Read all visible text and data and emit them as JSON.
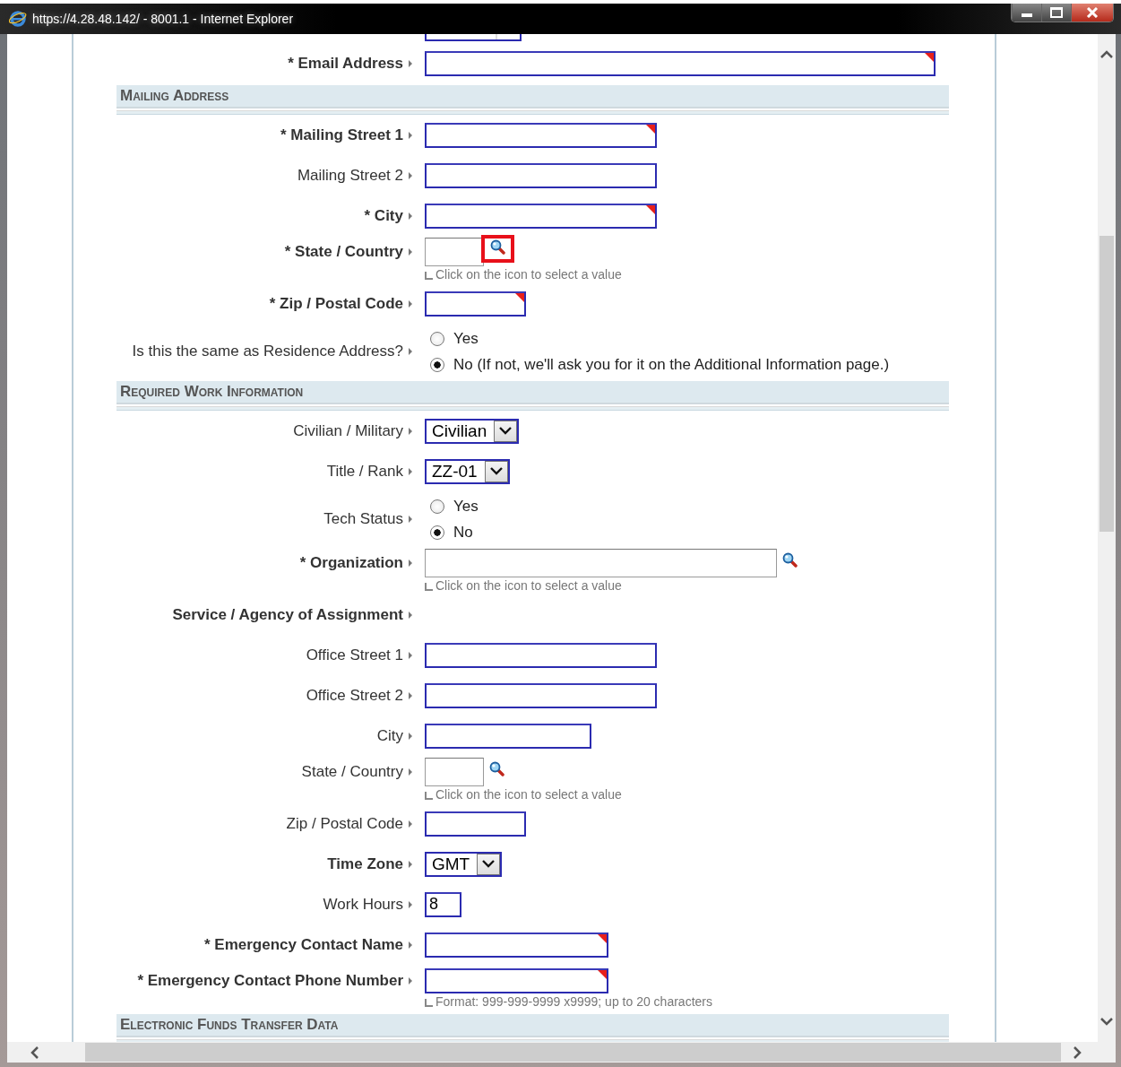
{
  "window": {
    "title": "https://4.28.48.142/ - 8001.1 - Internet Explorer"
  },
  "form": {
    "rows": [
      {
        "kind": "partial"
      },
      {
        "kind": "text",
        "label": "* Email Address",
        "bold": true,
        "field": {
          "kind": "xlarge"
        },
        "flagged": true
      },
      {
        "kind": "section",
        "label": "Mailing Address"
      },
      {
        "kind": "text",
        "label": "* Mailing Street 1",
        "bold": true,
        "field": {
          "kind": "large"
        },
        "flagged": true
      },
      {
        "kind": "text",
        "label": "Mailing Street 2",
        "bold": false,
        "field": {
          "kind": "large"
        },
        "flagged": false
      },
      {
        "kind": "text",
        "label": "* City",
        "bold": true,
        "field": {
          "kind": "large"
        },
        "flagged": true
      },
      {
        "kind": "lookup",
        "label": "* State / Country",
        "bold": true,
        "field": {
          "kind": "mini"
        },
        "highlighted": true,
        "hint": "Click on the icon to select a value"
      },
      {
        "kind": "text",
        "label": "* Zip / Postal Code",
        "bold": true,
        "field": {
          "kind": "short"
        },
        "flagged": true
      },
      {
        "kind": "radio",
        "label": "Is this the same as Residence Address?",
        "bold": false,
        "options": [
          {
            "label": "Yes",
            "selected": false
          },
          {
            "label": "No (If not, we'll ask you for it on the Additional Information page.)",
            "selected": true
          }
        ]
      },
      {
        "kind": "section",
        "label": "Required Work Information"
      },
      {
        "kind": "select",
        "label": "Civilian / Military",
        "bold": false,
        "value": "Civilian"
      },
      {
        "kind": "select",
        "label": "Title / Rank",
        "bold": false,
        "value": "ZZ-01"
      },
      {
        "kind": "radio",
        "label": "Tech Status",
        "bold": false,
        "options": [
          {
            "label": "Yes",
            "selected": false
          },
          {
            "label": "No",
            "selected": true
          }
        ]
      },
      {
        "kind": "lookup",
        "label": "* Organization",
        "bold": true,
        "field": {
          "kind": "wide"
        },
        "highlighted": false,
        "hint": "Click on the icon to select a value"
      },
      {
        "kind": "label",
        "label": "Service / Agency of Assignment",
        "bold": true
      },
      {
        "kind": "text",
        "label": "Office Street 1",
        "bold": false,
        "field": {
          "kind": "large"
        },
        "flagged": false
      },
      {
        "kind": "text",
        "label": "Office Street 2",
        "bold": false,
        "field": {
          "kind": "large"
        },
        "flagged": false
      },
      {
        "kind": "text",
        "label": "City",
        "bold": false,
        "field": {
          "kind": "compact"
        },
        "flagged": false
      },
      {
        "kind": "lookup",
        "label": "State / Country",
        "bold": false,
        "field": {
          "kind": "mini"
        },
        "highlighted": false,
        "hint": "Click on the icon to select a value"
      },
      {
        "kind": "text",
        "label": "Zip / Postal Code",
        "bold": false,
        "field": {
          "kind": "short"
        },
        "flagged": false
      },
      {
        "kind": "select",
        "label": "Time Zone",
        "bold": true,
        "value": "GMT"
      },
      {
        "kind": "text",
        "label": "Work Hours",
        "bold": false,
        "field": {
          "kind": "tiny"
        },
        "flagged": false,
        "value": "8"
      },
      {
        "kind": "text",
        "label": "* Emergency Contact Name",
        "bold": true,
        "field": {
          "kind": "medium"
        },
        "flagged": true
      },
      {
        "kind": "text",
        "label": "* Emergency Contact Phone Number",
        "bold": true,
        "field": {
          "kind": "medium"
        },
        "flagged": true,
        "hint": "Format: 999-999-9999 x9999; up to 20 characters"
      },
      {
        "kind": "section",
        "label": "Electronic Funds Transfer Data"
      }
    ]
  }
}
